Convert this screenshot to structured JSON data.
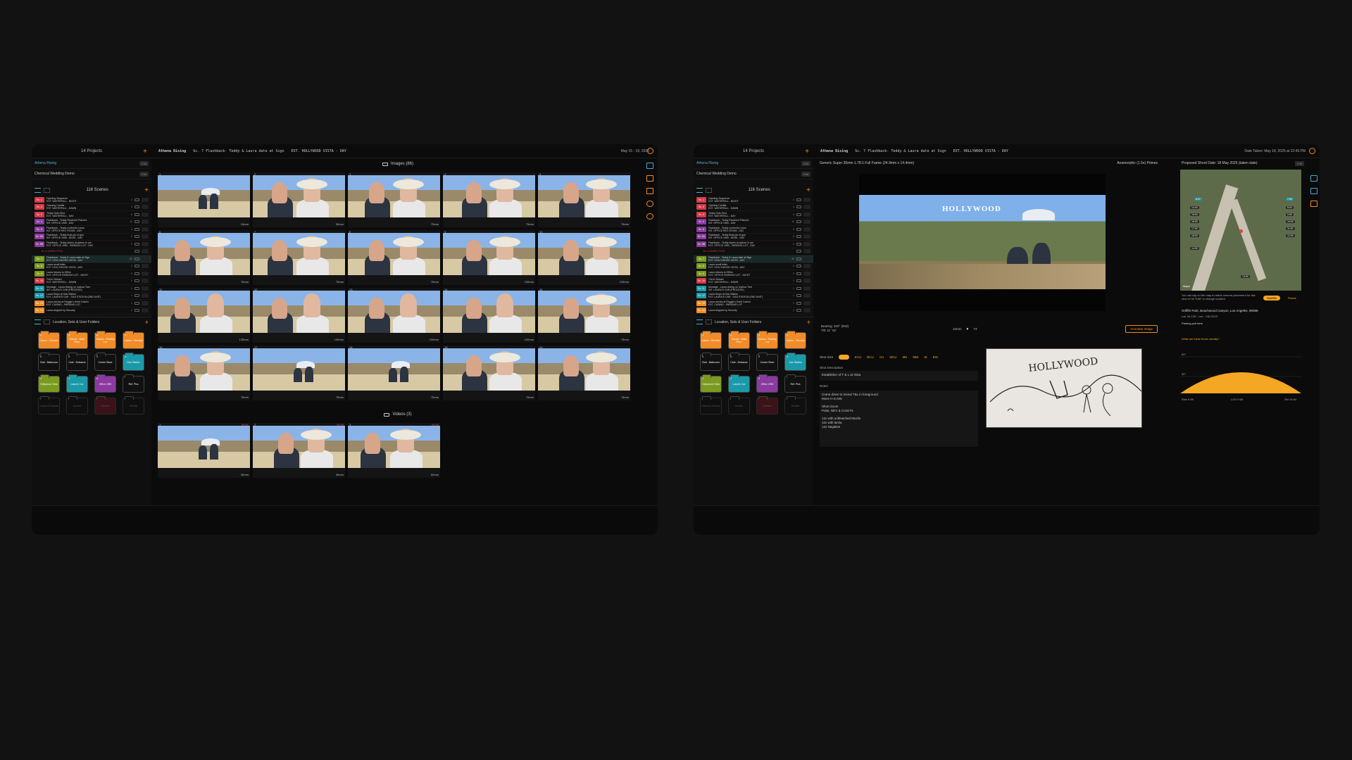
{
  "left": {
    "projects_title": "14 Projects",
    "breadcrumb": {
      "project": "Athena Rising",
      "scene": "Sc. 7 Flashback- Teddy & Laura date at Sign",
      "location": "EXT. HOLLYWOOD VISTA - DAY"
    },
    "date_range": "May 15 - 19, 2025",
    "projects": [
      {
        "name": "Athena Rising",
        "edit": "Edit"
      },
      {
        "name": "Chemical Wedding Demo",
        "edit": "Edit"
      }
    ],
    "scenes_title": "116 Scenes",
    "scenes": [
      {
        "badge": "Sc. 1",
        "color": "#d63a4a",
        "line1": "Opening Sequence",
        "line2": "EXT. WATERFALL - NIGHT",
        "num": "4"
      },
      {
        "badge": "Sc. 2",
        "color": "#d63a4a",
        "line1": "Opening Credits",
        "line2": "EXT. WATERFALL - DAWN",
        "num": "4"
      },
      {
        "badge": "Sc. 3",
        "color": "#d63a4a",
        "line1": "Teddy Gets Shot",
        "line2": "EXT. WATERFALL - DAY",
        "num": "4"
      },
      {
        "badge": "Sc. 4",
        "color": "#8a3aa0",
        "line1": "Flashback - Teddy Receives Pictures",
        "line2": "INT. OFFICE 1950 - DAY",
        "num": "11"
      },
      {
        "badge": "Sc. 5",
        "color": "#8a3aa0",
        "line1": "Flashback - Teddy confronts Laura",
        "line2": "INT. OFFICE REC ROOM - DAY",
        "num": "4"
      },
      {
        "badge": "Sc. 5A",
        "color": "#8a3aa0",
        "line1": "Flashback - Teddy finds pic of gun",
        "line2": "INT. OFFICE 1950 - DESK - DAY",
        "num": "3"
      },
      {
        "badge": "Sc. 5B",
        "color": "#8a3aa0",
        "line1": "Flashback - Teddy stares at picture in car",
        "line2": "EXT. OFFICE 1950 - PARKING LOT - DAY",
        "num": "2"
      },
      {
        "badge": "Sc. 6 UNSPLITTED",
        "color": "#d63a4a",
        "line1": "",
        "line2": "",
        "num": ""
      },
      {
        "badge": "Sc. 7",
        "color": "#7a9a20",
        "line1": "Flashback - Teddy & Laura date at Sign",
        "line2": "EXT. HOLLYWOOD VISTA - DAY",
        "num": "30"
      },
      {
        "badge": "Sc. 8",
        "color": "#7a9a20",
        "line1": "Laura recall letter",
        "line2": "EXT. HOLLYWOOD VISTA - DAY",
        "num": "2"
      },
      {
        "badge": "Sc. 9",
        "color": "#7a9a20",
        "line1": "Laura returns to Office",
        "line2": "EXT. OFFICE PARKING LOT - NIGHT",
        "num": "3"
      },
      {
        "badge": "Sc. 10",
        "color": "#d63a4a",
        "line1": "Out in Stream",
        "line2": "EXT. WATERFALL - DAWN",
        "num": "1"
      },
      {
        "badge": "Sc. 11",
        "color": "#1a9aa8",
        "line1": "Montage - Laura driving on Joshua Tree",
        "line2": "INT. LAURA'S CAR (PROCESS)",
        "num": "1"
      },
      {
        "badge": "Sc. 12",
        "color": "#1a9aa8",
        "line1": "Laura Stops at Gas Station",
        "line2": "EXT. LAURA'S CAR - GAS STATION (2ND UNIT)",
        "num": "1"
      },
      {
        "badge": "Sc. 13",
        "color": "#f28c28",
        "line1": "Laura arrives at Reggie's Hotel Casino",
        "line2": "EXT. CASINO - PARKING LOT",
        "num": "1"
      },
      {
        "badge": "Sc. 14",
        "color": "#f28c28",
        "line1": "Laura stopped by Security",
        "line2": "",
        "num": "1"
      }
    ],
    "folders_title": "Location, Sets & User Folders",
    "folders": [
      {
        "label": "Casino - Elevator",
        "num": "3",
        "color": "#f28c28"
      },
      {
        "label": "Casino - Main Floor",
        "num": "5",
        "color": "#f28c28"
      },
      {
        "label": "Casino - Parking Lot",
        "num": "6",
        "color": "#f28c28"
      },
      {
        "label": "Casino - Security",
        "num": "5",
        "color": "#f28c28"
      },
      {
        "label": "Club - Bathroom",
        "num": "4",
        "color": "#111111"
      },
      {
        "label": "Club - Entrance",
        "num": "2",
        "color": "#111111"
      },
      {
        "label": "Corner Store",
        "num": "2",
        "color": "#111111"
      },
      {
        "label": "Gas Station",
        "num": "3",
        "color": "#1a9aa8"
      },
      {
        "label": "Hollywood Vista",
        "num": "3",
        "color": "#7a9a20"
      },
      {
        "label": "Laura's Car",
        "num": "3",
        "color": "#1a9aa8"
      },
      {
        "label": "Office 1950",
        "num": "5",
        "color": "#8a3aa0"
      },
      {
        "label": "Ref. Pics",
        "num": "",
        "color": "#111111"
      },
      {
        "label": "Unsaved Frames",
        "num": "",
        "color": "#0f0f0f"
      },
      {
        "label": "Archive",
        "num": "",
        "color": "#0f0f0f"
      },
      {
        "label": "Deleted",
        "num": "",
        "color": "#3a1218"
      },
      {
        "label": "Shotlist",
        "num": "",
        "color": "#0f0f0f"
      }
    ],
    "images_title": "Images (86)",
    "images": [
      {
        "n": "1",
        "mm": "24mm"
      },
      {
        "n": "2",
        "mm": "55mm"
      },
      {
        "n": "3",
        "mm": "75mm"
      },
      {
        "n": "4",
        "mm": "75mm"
      },
      {
        "n": "5",
        "mm": "75mm"
      },
      {
        "n": "6",
        "mm": "75mm"
      },
      {
        "n": "7",
        "mm": "75mm"
      },
      {
        "n": "8",
        "mm": "75mm"
      },
      {
        "n": "9",
        "mm": "135mm"
      },
      {
        "n": "10",
        "mm": "135mm"
      },
      {
        "n": "11",
        "mm": "135mm"
      },
      {
        "n": "12",
        "mm": "100mm"
      },
      {
        "n": "13",
        "mm": "100mm"
      },
      {
        "n": "14",
        "mm": "100mm"
      },
      {
        "n": "15",
        "mm": "75mm"
      },
      {
        "n": "16",
        "mm": "75mm"
      },
      {
        "n": "17",
        "mm": "75mm"
      },
      {
        "n": "18",
        "mm": "75mm"
      },
      {
        "n": "19",
        "mm": "75mm"
      },
      {
        "n": "20",
        "mm": "75mm"
      }
    ],
    "videos_title": "Videos (3)",
    "videos": [
      {
        "n": "1",
        "mm": "30mm",
        "t": "00:51"
      },
      {
        "n": "2",
        "mm": "30mm",
        "t": "00:09"
      },
      {
        "n": "3",
        "mm": "50mm",
        "t": "00:04"
      }
    ]
  },
  "right": {
    "projects_title": "14 Projects",
    "breadcrumb": {
      "project": "Athena Rising",
      "scene": "Sc. 7 Flashback- Teddy & Laura date at Sign",
      "location": "EXT. HOLLYWOOD VISTA - DAY"
    },
    "date_taken": "Date Taken: May 18, 2025 at 12:49 PM",
    "camera_format": "Generic Super 35mm 1.78:1 Full Frame (24.9mm x 14.4mm)",
    "lens_set": "Anamorphic (1.5x) Primes",
    "bearing": "Bearing: 320° (NW)",
    "tilt": "Tilt: 11° 52'",
    "focal": "24mm",
    "focal_alt": "74'",
    "annotate": "Annotate Image",
    "shot_size_label": "Shot Size",
    "shot_sizes": [
      "ECU",
      "BCU",
      "CU",
      "MCU",
      "MS",
      "MW",
      "W",
      "EW"
    ],
    "shot_desc_label": "Shot Description",
    "shot_desc": "Establisher of T & L at Vista",
    "notes_label": "Notes",
    "notes": [
      "Crane down to reveal T&L in foreground",
      "Move in to MS",
      "",
      "Short Zoom",
      "Polar, ND's & Coral #1",
      "",
      "12x with unbleached Muslin",
      "12x with lamia",
      "12x Negative"
    ],
    "sketch_text": "HOLLYWOOD",
    "shoot_date": "Proposed Shoot Date: 18 May 2025 (taken date)",
    "edit": "Edit",
    "map_hint": "You can tap on the map to refine camera placement for this shot or hit \"Edit\" to change location.",
    "map_btn_on": "Satellite",
    "map_btn_off": "Roads",
    "place": "Griffith Park, Beachwood Canyon, Los Angeles, 90068",
    "coords": "Lat: 34.133°, Lon: -118.3213°",
    "parking": "Parking pull here",
    "sun_q": "What are these times usually?",
    "sun_rise": "Rise 6:59",
    "sun_noon": "LOO 9:55",
    "sun_set": "Set 16:54",
    "sun_deg1": "60°",
    "sun_deg2": "30°",
    "map_times": [
      "6:47",
      "14:00",
      "15:00",
      "16:00",
      "17:00",
      "18:00",
      "7:00",
      "8:00",
      "9:00",
      "10:00",
      "11:00",
      "12:00",
      "13:00",
      "14:00"
    ],
    "maps_label": "Maps"
  },
  "colors": {
    "accent": "#f28c28",
    "teal": "#4ab0d0",
    "panel": "#0b0b0b"
  }
}
